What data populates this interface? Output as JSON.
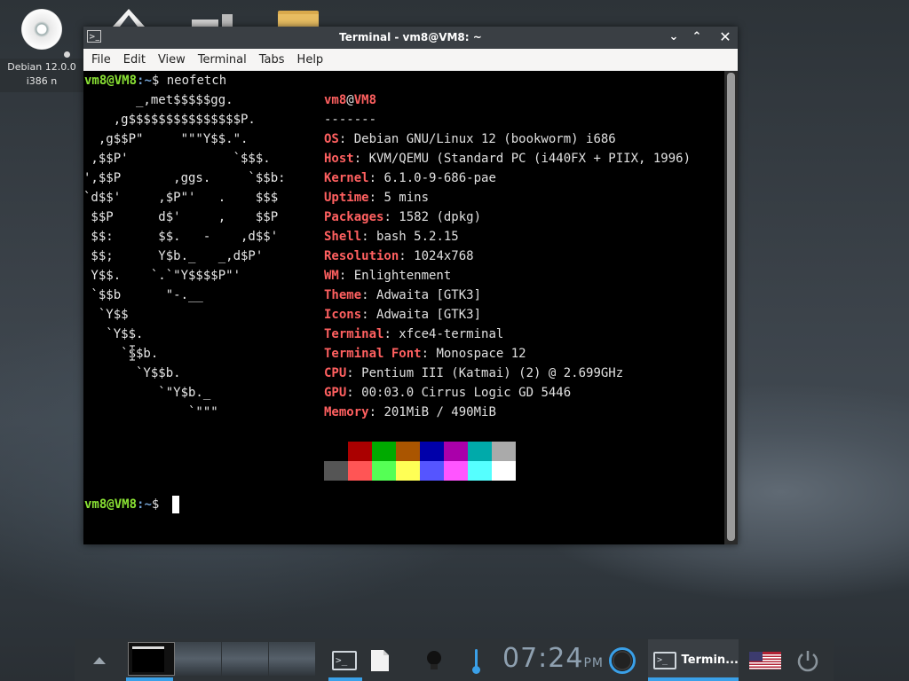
{
  "desktop": {
    "disc_label_line1": "Debian 12.0.0",
    "disc_label_line2": "i386 n"
  },
  "window": {
    "title": "Terminal - vm8@VM8: ~",
    "menu": [
      "File",
      "Edit",
      "View",
      "Terminal",
      "Tabs",
      "Help"
    ]
  },
  "terminal": {
    "prompt_user": "vm8@VM8",
    "prompt_path": ":~",
    "prompt_symbol": "$ ",
    "command": "neofetch",
    "logo": [
      "       _,met$$$$$gg.",
      "    ,g$$$$$$$$$$$$$$$P.",
      "  ,g$$P\"     \"\"\"Y$$.\".",
      " ,$$P'              `$$$.",
      "',$$P       ,ggs.     `$$b:",
      "`d$$'     ,$P\"'   .    $$$",
      " $$P      d$'     ,    $$P",
      " $$:      $$.   -    ,d$$'",
      " $$;      Y$b._   _,d$P'",
      " Y$$.    `.`\"Y$$$$P\"'",
      " `$$b      \"-.__",
      "  `Y$$",
      "   `Y$$.",
      "     `$$b.",
      "       `Y$$b.",
      "          `\"Y$b._",
      "              `\"\"\""
    ],
    "header_user": "vm8",
    "header_at": "@",
    "header_host": "VM8",
    "separator": "-------",
    "info": [
      {
        "key": "OS",
        "value": "Debian GNU/Linux 12 (bookworm) i686"
      },
      {
        "key": "Host",
        "value": "KVM/QEMU (Standard PC (i440FX + PIIX, 1996)"
      },
      {
        "key": "Kernel",
        "value": "6.1.0-9-686-pae"
      },
      {
        "key": "Uptime",
        "value": "5 mins"
      },
      {
        "key": "Packages",
        "value": "1582 (dpkg)"
      },
      {
        "key": "Shell",
        "value": "bash 5.2.15"
      },
      {
        "key": "Resolution",
        "value": "1024x768"
      },
      {
        "key": "WM",
        "value": "Enlightenment"
      },
      {
        "key": "Theme",
        "value": "Adwaita [GTK3]"
      },
      {
        "key": "Icons",
        "value": "Adwaita [GTK3]"
      },
      {
        "key": "Terminal",
        "value": "xfce4-terminal"
      },
      {
        "key": "Terminal Font",
        "value": "Monospace 12"
      },
      {
        "key": "CPU",
        "value": "Pentium III (Katmai) (2) @ 2.699GHz"
      },
      {
        "key": "GPU",
        "value": "00:03.0 Cirrus Logic GD 5446"
      },
      {
        "key": "Memory",
        "value": "201MiB / 490MiB"
      }
    ],
    "colors_row1": [
      "#000000",
      "#aa0000",
      "#00aa00",
      "#aa5500",
      "#0000aa",
      "#aa00aa",
      "#00aaaa",
      "#aaaaaa"
    ],
    "colors_row2": [
      "#555555",
      "#ff5555",
      "#55ff55",
      "#ffff55",
      "#5555ff",
      "#ff55ff",
      "#55ffff",
      "#ffffff"
    ]
  },
  "taskbar": {
    "clock_time": "07:24",
    "clock_ampm": "PM",
    "task_label": "Termin...",
    "accent": "#3aa0e8"
  }
}
